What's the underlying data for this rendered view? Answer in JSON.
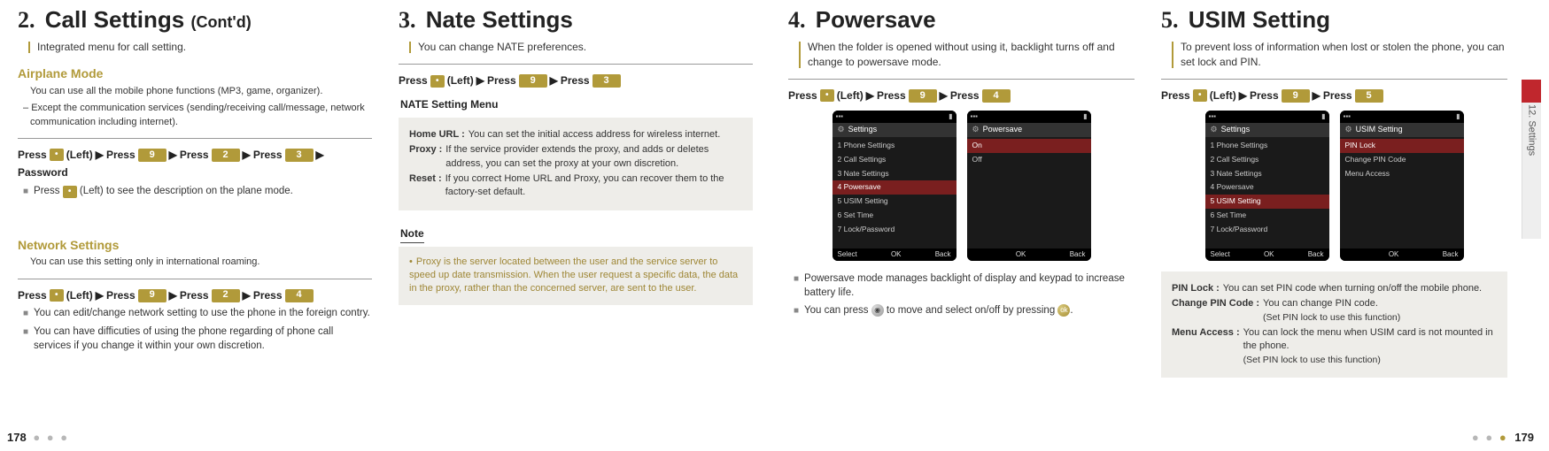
{
  "meta": {
    "left_page": "178",
    "right_page": "179",
    "side_tab": "12. Settings"
  },
  "sec2": {
    "num": "2.",
    "title": "Call Settings",
    "cont": "(Cont'd)",
    "intro": "Integrated menu for call setting.",
    "airplane": {
      "head": "Airplane Mode",
      "desc1": "You can use all the mobile phone functions (MP3, game, organizer).",
      "desc2": "Except the communication services (sending/receiving call/message, network communication including internet).",
      "press": {
        "p": "Press",
        "left": "(Left)",
        "keys": [
          "9",
          "2",
          "3"
        ],
        "tail": "Password"
      },
      "note": "(Left) to see the description on the plane mode.",
      "note_prefix": "Press"
    },
    "network": {
      "head": "Network Settings",
      "desc": "You can use this setting only in international roaming.",
      "press": {
        "p": "Press",
        "left": "(Left)",
        "keys": [
          "9",
          "2",
          "4"
        ]
      },
      "b1": "You can edit/change network setting to use the phone in the foreign contry.",
      "b2": "You can have difficuties of using the phone regarding of phone call services if you change it within your own discretion."
    }
  },
  "sec3": {
    "num": "3.",
    "title": "Nate Settings",
    "intro": "You can change NATE preferences.",
    "press": {
      "p": "Press",
      "left": "(Left)",
      "keys": [
        "9",
        "3"
      ]
    },
    "menu_label": "NATE Setting Menu",
    "defs": {
      "home_k": "Home URL :",
      "home_v": "You can set the initial access address for wireless internet.",
      "proxy_k": "Proxy :",
      "proxy_v": "If the service provider extends the proxy, and adds or deletes address, you can set the proxy at your own discretion.",
      "reset_k": "Reset :",
      "reset_v": "If you correct Home URL and Proxy, you can recover them to the factory-set default."
    },
    "note_label": "Note",
    "note": "Proxy is the server located between the user and the service server to speed up date transmission. When the user request a specific data, the data in the proxy, rather than the concerned server, are sent to the user."
  },
  "sec4": {
    "num": "4.",
    "title": "Powersave",
    "intro": "When the folder is opened without using it, backlight turns off and change to powersave mode.",
    "press": {
      "p": "Press",
      "left": "(Left)",
      "keys": [
        "9",
        "4"
      ]
    },
    "phone1": {
      "title": "Settings",
      "items": [
        "1 Phone Settings",
        "2 Call Settings",
        "3 Nate Settings",
        "4 Powersave",
        "5 USIM Setting",
        "6 Set Time",
        "7 Lock/Password"
      ],
      "hl_index": 3,
      "soft": [
        "Select",
        "OK",
        "Back"
      ]
    },
    "phone2": {
      "title": "Powersave",
      "items": [
        "On",
        "Off"
      ],
      "hl_index": 0,
      "soft": [
        "",
        "OK",
        "Back"
      ]
    },
    "b1": "Powersave mode manages backlight of display and keypad to increase battery life.",
    "b2a": "You can press",
    "b2b": "to move and select on/off by pressing",
    "b2c": "."
  },
  "sec5": {
    "num": "5.",
    "title": "USIM Setting",
    "intro": "To prevent loss of information when lost or stolen the phone, you can set lock and PIN.",
    "press": {
      "p": "Press",
      "left": "(Left)",
      "keys": [
        "9",
        "5"
      ]
    },
    "phone1": {
      "title": "Settings",
      "items": [
        "1 Phone Settings",
        "2 Call Settings",
        "3 Nate Settings",
        "4 Powersave",
        "5 USIM Setting",
        "6 Set Time",
        "7 Lock/Password"
      ],
      "hl_index": 4,
      "soft": [
        "Select",
        "OK",
        "Back"
      ]
    },
    "phone2": {
      "title": "USIM Setting",
      "items": [
        "PIN Lock",
        "Change PIN Code",
        "Menu Access"
      ],
      "hl_index": 0,
      "soft": [
        "",
        "OK",
        "Back"
      ]
    },
    "defs": {
      "pin_k": "PIN Lock :",
      "pin_v": "You can set PIN code when turning on/off the mobile phone.",
      "cpc_k": "Change PIN Code :",
      "cpc_v": "You can change PIN code.",
      "cpc_sub": "(Set PIN lock to use this function)",
      "ma_k": "Menu Access :",
      "ma_v": "You can lock the menu when USIM card is not mounted in the phone.",
      "ma_sub": "(Set PIN lock to use this function)"
    }
  }
}
